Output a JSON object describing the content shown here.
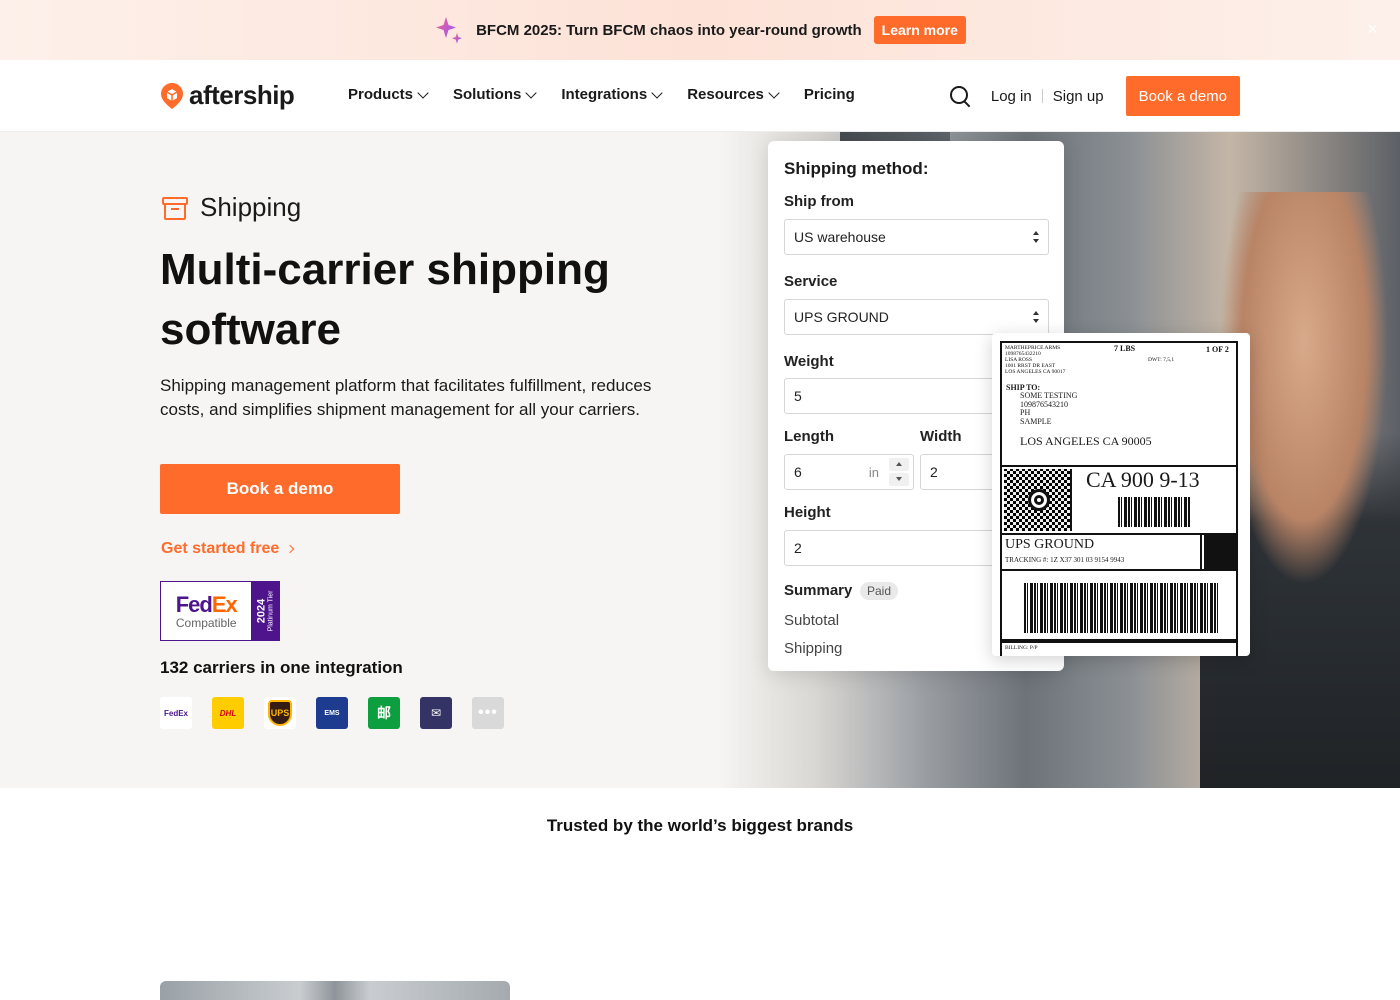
{
  "announcement": {
    "text": "BFCM 2025: Turn BFCM chaos into year-round growth",
    "button": "Learn more",
    "close": "×"
  },
  "nav": {
    "logo": "aftership",
    "links": [
      "Products",
      "Solutions",
      "Integrations",
      "Resources",
      "Pricing"
    ],
    "login": "Log in",
    "signup": "Sign up",
    "demo": "Book a demo"
  },
  "hero": {
    "category": "Shipping",
    "title": "Multi-carrier shipping software",
    "description": "Shipping management platform that facilitates fulfillment, reduces costs, and simplifies shipment management for all your carriers.",
    "cta": "Book a demo",
    "free_link": "Get started free",
    "badge": {
      "brand_fe": "Fed",
      "brand_ex": "Ex",
      "compat": "Compatible",
      "year": "2024",
      "tier": "Platinum Tier"
    },
    "carriers_title": "132 carriers in one integration",
    "carriers": [
      {
        "name": "fedex",
        "text": "FedEx"
      },
      {
        "name": "dhl",
        "text": "DHL"
      },
      {
        "name": "ups",
        "text": "UPS"
      },
      {
        "name": "ems",
        "text": "EMS"
      },
      {
        "name": "china-post",
        "text": "邮"
      },
      {
        "name": "usps",
        "text": "✉"
      },
      {
        "name": "more",
        "text": "•••"
      }
    ]
  },
  "form": {
    "title": "Shipping method:",
    "ship_from_label": "Ship from",
    "ship_from_value": "US warehouse",
    "service_label": "Service",
    "service_value": "UPS GROUND",
    "weight_label": "Weight",
    "weight_value": "5",
    "length_label": "Length",
    "length_value": "6",
    "length_unit": "in",
    "width_label": "Width",
    "width_value": "2",
    "height_label": "Height",
    "height_value": "2",
    "summary_label": "Summary",
    "summary_badge": "Paid",
    "subtotal_label": "Subtotal",
    "shipping_label": "Shipping"
  },
  "label": {
    "sender": [
      "MARTHEPRICE ARMS",
      "1098765432210",
      "LISA ROSS",
      "1001 RRST DR EAST",
      "LOS ANGELES CA 90017"
    ],
    "weight": "7 LBS",
    "count": "1 OF 2",
    "dwt": "DWT: 7,5,1",
    "ship_to": "SHIP TO:",
    "address": [
      "SOME TESTING",
      "109876543210",
      "PH",
      "SAMPLE"
    ],
    "city": "LOS ANGELES  CA 90005",
    "code": "CA 900 9-13",
    "service": "UPS GROUND",
    "tracking": "TRACKING #: 1Z X37 301 03 9154 9943",
    "billing": "BILLING: P/P"
  },
  "trusted": "Trusted by the world’s biggest brands",
  "colors": {
    "accent": "#ff6b2b",
    "fedex_purple": "#4d148c"
  }
}
